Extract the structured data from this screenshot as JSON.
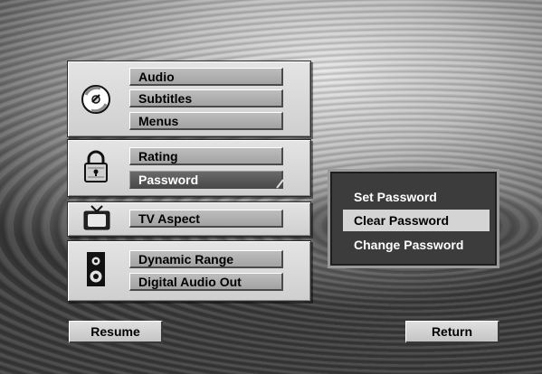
{
  "menu": {
    "audio_group": {
      "icon": "disc-icon",
      "items": [
        {
          "label": "Audio"
        },
        {
          "label": "Subtitles"
        },
        {
          "label": "Menus"
        }
      ]
    },
    "rating_group": {
      "icon": "padlock-icon",
      "items": [
        {
          "label": "Rating"
        },
        {
          "label": "Password",
          "selected": true
        }
      ]
    },
    "tv_group": {
      "icon": "tv-icon",
      "items": [
        {
          "label": "TV Aspect"
        }
      ]
    },
    "speaker_group": {
      "icon": "speaker-icon",
      "items": [
        {
          "label": "Dynamic Range"
        },
        {
          "label": "Digital Audio Out"
        }
      ]
    }
  },
  "password_submenu": {
    "items": [
      {
        "label": "Set Password"
      },
      {
        "label": "Clear Password",
        "highlighted": true
      },
      {
        "label": "Change Password"
      }
    ]
  },
  "footer": {
    "resume_label": "Resume",
    "return_label": "Return"
  }
}
